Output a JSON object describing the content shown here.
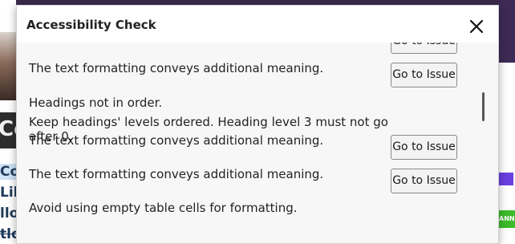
{
  "dialog": {
    "title": "Accessibility Check",
    "close_icon": "close-icon",
    "issue_button_label": "Go to Issue",
    "issues": [
      {
        "text": "The text formatting conveys additional meaning."
      },
      {
        "text": "Headings not in order."
      },
      {
        "text": "Keep headings' levels ordered. Heading level 3 must not go after 0."
      },
      {
        "text": "The text formatting conveys additional meaning."
      },
      {
        "text": "The text formatting conveys additional meaning."
      },
      {
        "text": "Avoid using empty table cells for formatting."
      }
    ]
  },
  "background": {
    "big_text": "Co",
    "lines": [
      "Col",
      "Lib",
      "llo",
      "tlo"
    ],
    "green_tag": "ANN"
  }
}
